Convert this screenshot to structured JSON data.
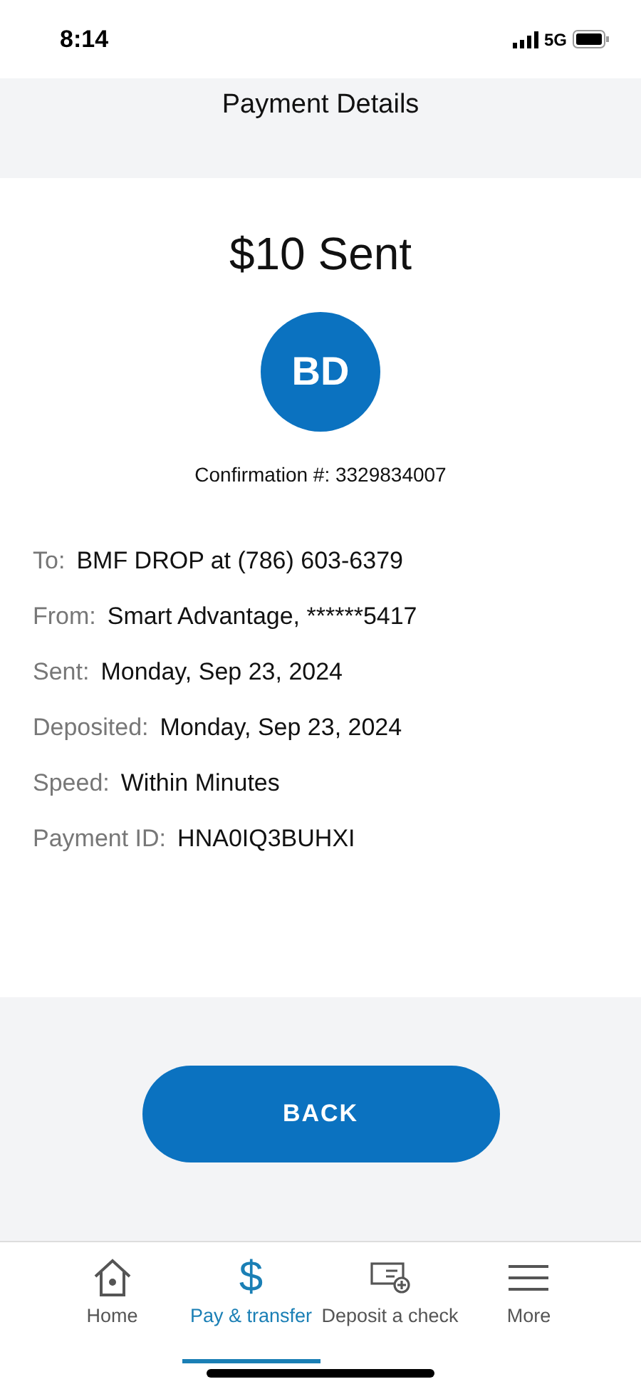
{
  "status_bar": {
    "time": "8:14",
    "network": "5G"
  },
  "header": {
    "title": "Payment Details"
  },
  "amount": "$10 Sent",
  "avatar": {
    "initials": "BD"
  },
  "confirmation": "Confirmation #: 3329834007",
  "details": [
    {
      "label": "To:",
      "value": "BMF DROP at (786) 603-6379"
    },
    {
      "label": "From:",
      "value": "Smart Advantage, ******5417"
    },
    {
      "label": "Sent:",
      "value": "Monday, Sep 23, 2024"
    },
    {
      "label": "Deposited:",
      "value": "Monday, Sep 23, 2024"
    },
    {
      "label": "Speed:",
      "value": "Within Minutes"
    },
    {
      "label": "Payment ID:",
      "value": "HNA0IQ3BUHXI"
    }
  ],
  "back_button": "BACK",
  "nav": [
    {
      "kind": "home",
      "label": "Home",
      "selected": false
    },
    {
      "kind": "glyph",
      "glyph": "$",
      "label": "Pay & transfer",
      "selected": true
    },
    {
      "kind": "check",
      "label": "Deposit a check",
      "selected": false
    },
    {
      "kind": "menu",
      "label": "More",
      "selected": false
    }
  ]
}
